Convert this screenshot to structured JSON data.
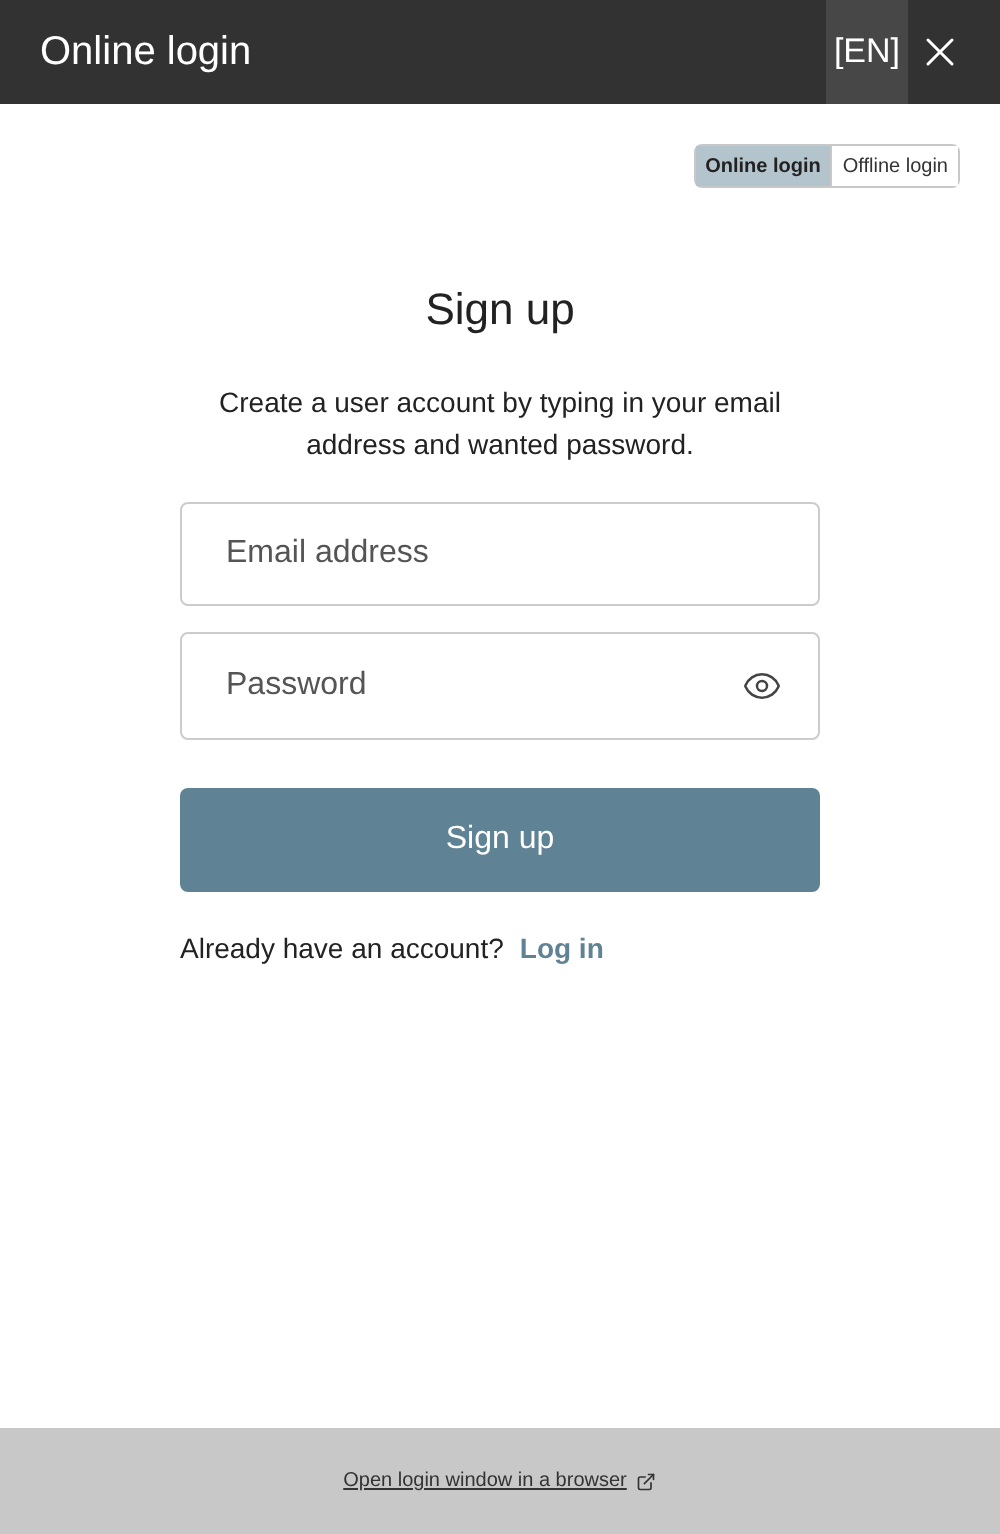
{
  "window": {
    "title": "Online login",
    "language": "[EN]"
  },
  "mode_tabs": [
    {
      "label": "Online login",
      "selected": true
    },
    {
      "label": "Offline login",
      "selected": false
    }
  ],
  "heading": "Sign up",
  "description": "Create a user account by typing in your email address and wanted password.",
  "fields": [
    {
      "kind": "email",
      "placeholder": "Email address"
    },
    {
      "kind": "password",
      "placeholder": "Password"
    }
  ],
  "submit": "Sign up",
  "login_prompt": {
    "text": "Already have an account?",
    "link": "Log in"
  },
  "footer": {
    "link": "Open login window in a browser"
  }
}
